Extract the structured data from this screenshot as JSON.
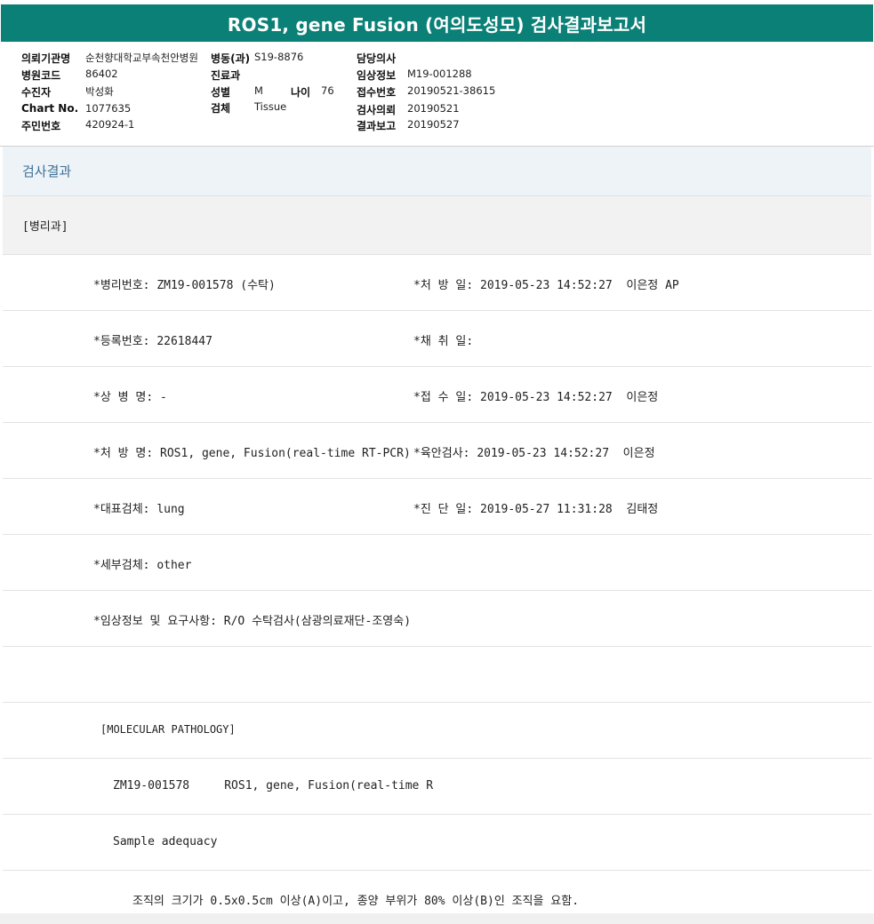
{
  "title": "ROS1, gene Fusion (여의도성모) 검사결과보고서",
  "info": {
    "institution_label": "의뢰기관명",
    "institution_value": "순천향대학교부속천안병원",
    "ward_label": "병동(과)",
    "ward_value": "S19-8876",
    "doctor_label": "담당의사",
    "doctor_value": "",
    "hospital_code_label": "병원코드",
    "hospital_code_value": "86402",
    "dept_label": "진료과",
    "dept_value": "",
    "clinical_label": "임상정보",
    "clinical_value": "M19-001288",
    "patient_label": "수진자",
    "patient_value": "박성화",
    "sex_label": "성별",
    "sex_value": "M",
    "age_label": "나이",
    "age_value": "76",
    "receipt_label": "접수번호",
    "receipt_value": "20190521-38615",
    "chart_label": "Chart No.",
    "chart_value": "1077635",
    "specimen_label": "검체",
    "specimen_value": "Tissue",
    "request_label": "검사의뢰",
    "request_value": "20190521",
    "resident_label": "주민번호",
    "resident_value": "420924-1",
    "report_label": "결과보고",
    "report_value": "20190527"
  },
  "section_title": "검사결과",
  "department": "[병리과]",
  "rows": [
    {
      "left": "*병리번호: ZM19-001578 (수탁)",
      "right": "*처 방 일: 2019-05-23 14:52:27  이은정 AP"
    },
    {
      "left": "*등록번호: 22618447",
      "right": "*채 취 일:"
    },
    {
      "left": "*상 병 명: -",
      "right": "*접 수 일: 2019-05-23 14:52:27  이은정"
    },
    {
      "left": "*처 방 명: ROS1, gene, Fusion(real-time RT-PCR)",
      "right": "*육안검사: 2019-05-23 14:52:27  이은정"
    },
    {
      "left": "*대표검체: lung",
      "right": "*진 단 일: 2019-05-27 11:31:28  김태정"
    },
    {
      "left": "*세부검체: other",
      "right": ""
    },
    {
      "left": "*임상정보 및 요구사항: R/O 수탁검사(삼광의료재단-조영숙)",
      "right": ""
    },
    {
      "left": "",
      "right": ""
    }
  ],
  "molecular_header": "[MOLECULAR PATHOLOGY]",
  "test_line": "ZM19-001578     ROS1, gene, Fusion(real-time R",
  "sample_adequacy": "Sample adequacy",
  "adequacy_note": "조직의 크기가 0.5x0.5cm 이상(A)이고, 종양 부위가 80% 이상(B)인 조직을 요함."
}
